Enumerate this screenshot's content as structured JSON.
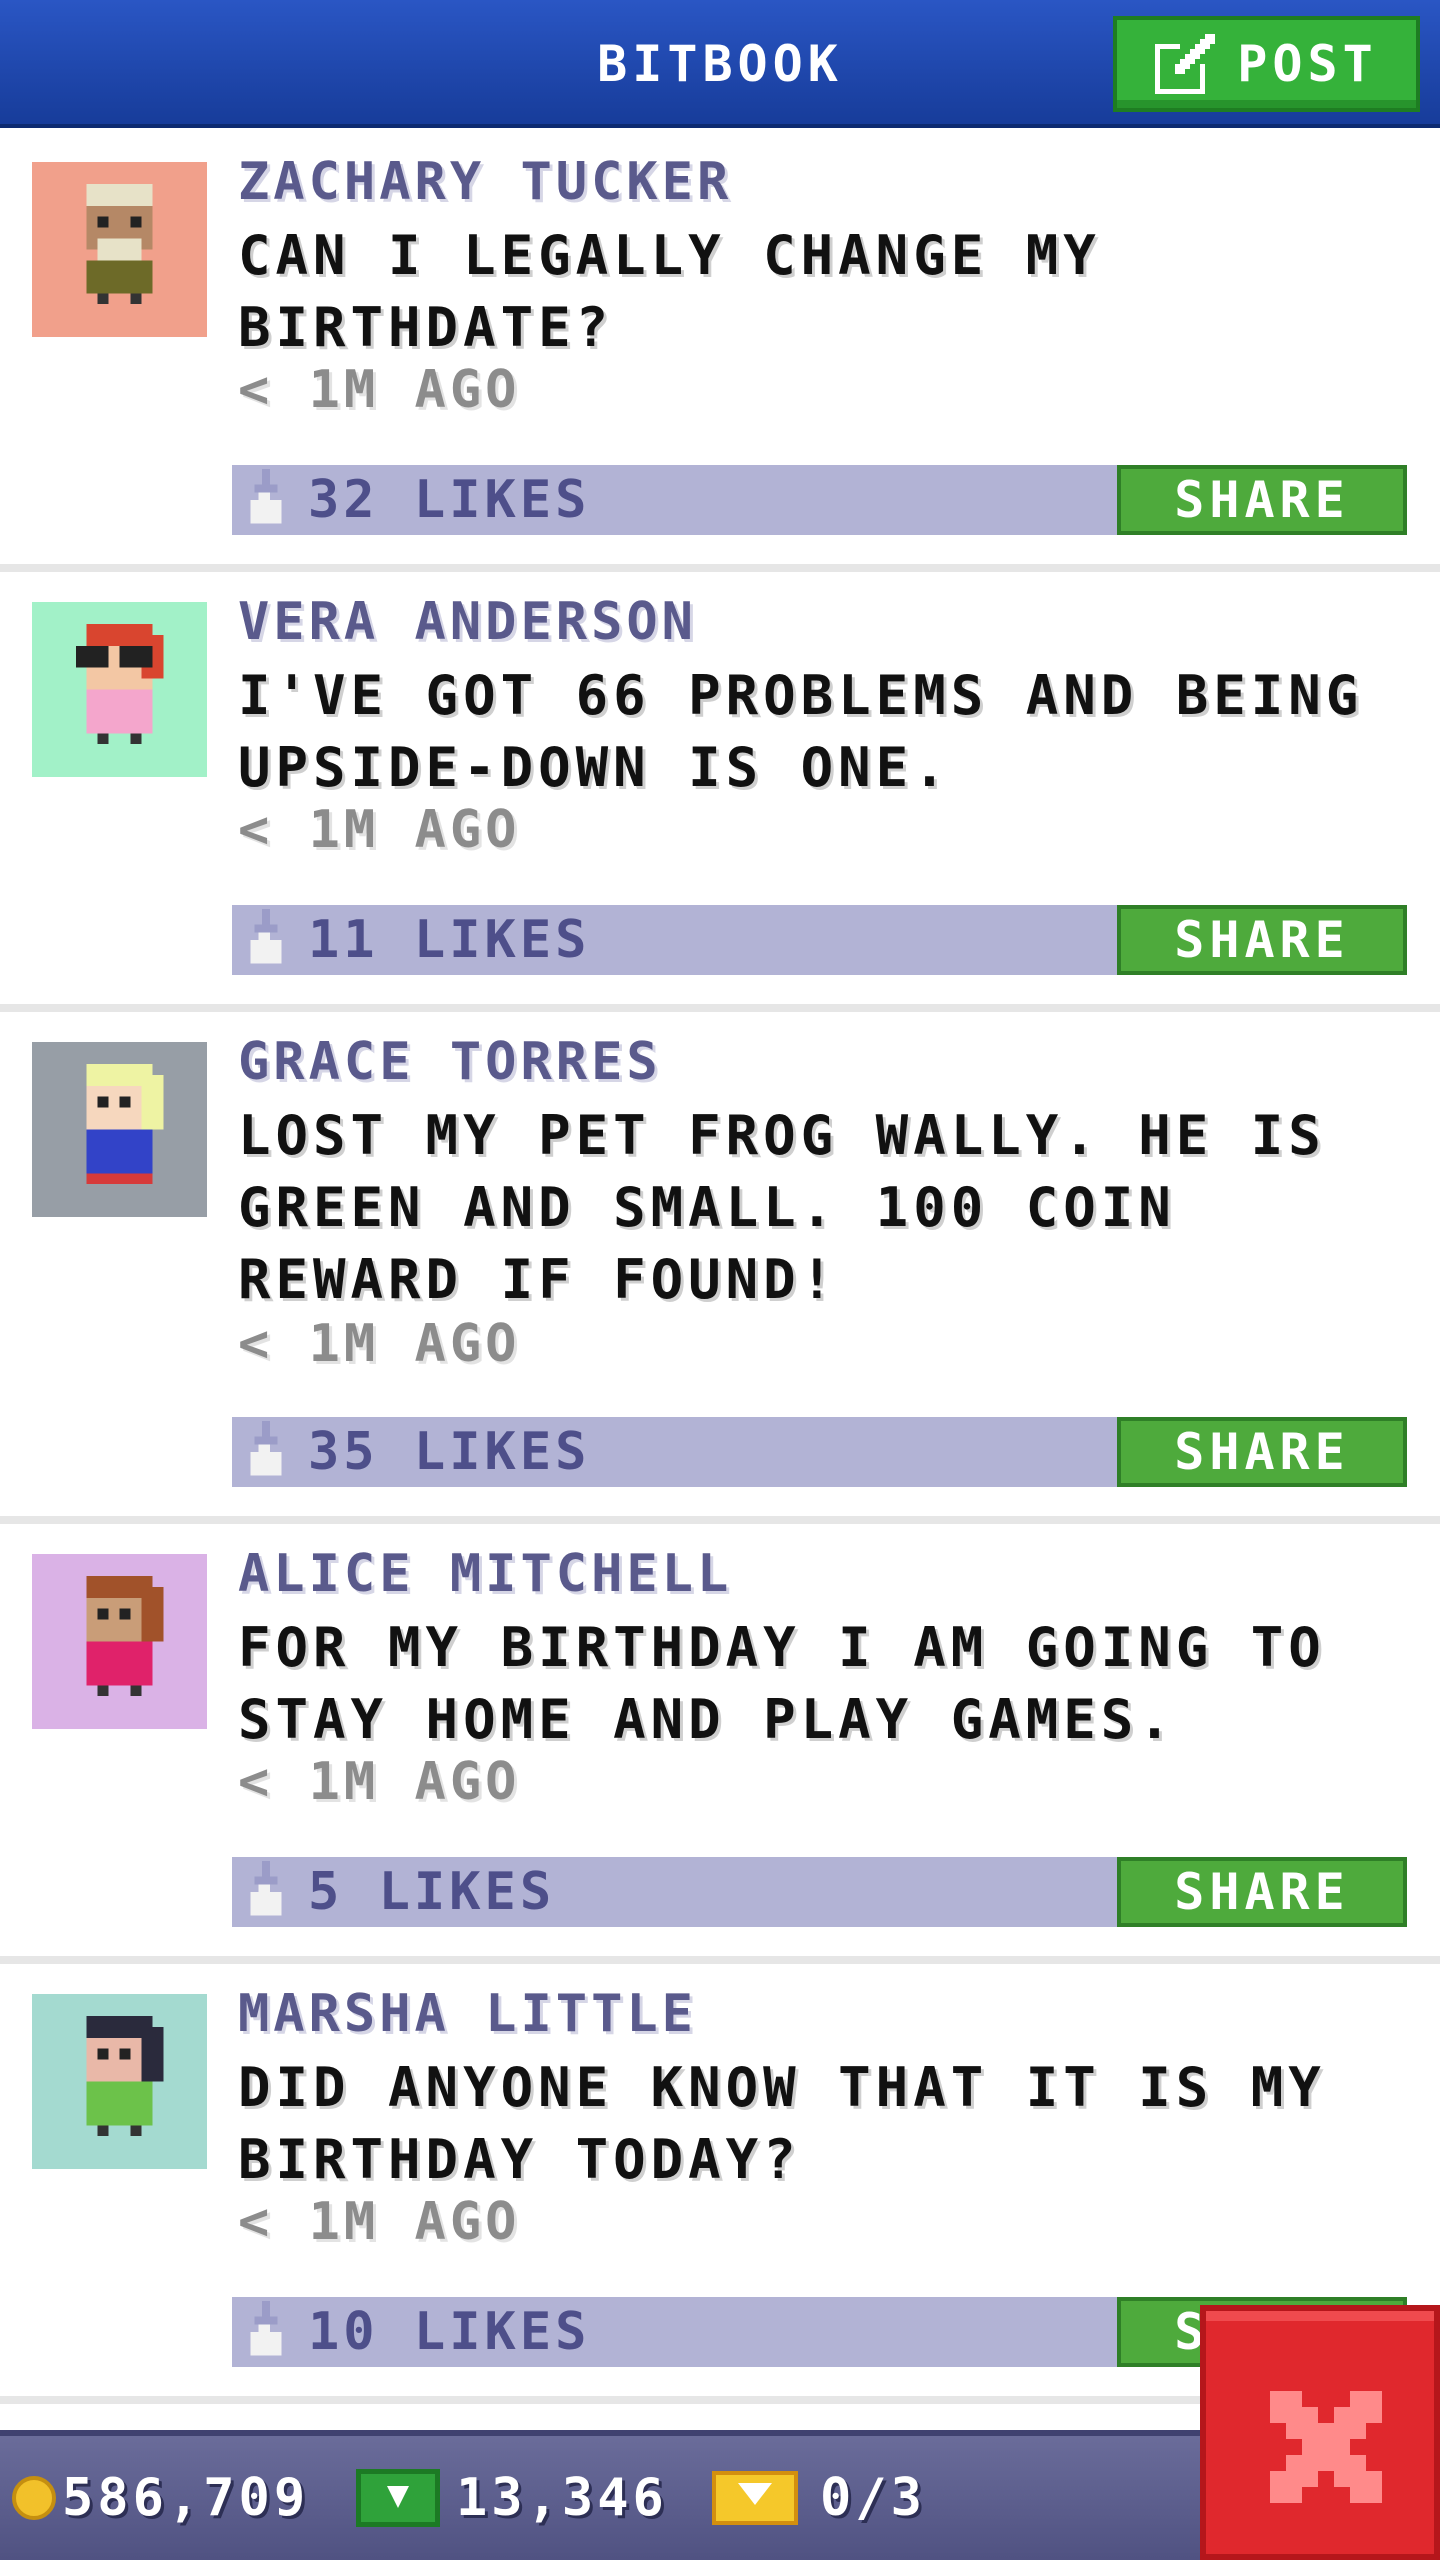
{
  "header": {
    "title": "BITBOOK",
    "post_label": "POST"
  },
  "posts": [
    {
      "author": "ZACHARY TUCKER",
      "message": "CAN I LEGALLY CHANGE MY BIRTHDATE?",
      "time": "< 1M AGO",
      "likes": "32 LIKES",
      "share_label": "SHARE",
      "avatar_bg": "#f1a08b"
    },
    {
      "author": "VERA ANDERSON",
      "message": "I'VE GOT 66 PROBLEMS AND BEING UPSIDE-DOWN IS ONE.",
      "time": "< 1M AGO",
      "likes": "11 LIKES",
      "share_label": "SHARE",
      "avatar_bg": "#a2f1c8"
    },
    {
      "author": "GRACE TORRES",
      "message": "LOST MY PET FROG WALLY. HE IS GREEN AND SMALL. 100 COIN REWARD IF FOUND!",
      "time": "< 1M AGO",
      "likes": "35 LIKES",
      "share_label": "SHARE",
      "avatar_bg": "#979ea6"
    },
    {
      "author": "ALICE MITCHELL",
      "message": "FOR MY BIRTHDAY I AM GOING TO STAY HOME AND PLAY GAMES.",
      "time": "< 1M AGO",
      "likes": "5 LIKES",
      "share_label": "SHARE",
      "avatar_bg": "#dab2e6"
    },
    {
      "author": "MARSHA LITTLE",
      "message": "DID ANYONE KNOW THAT IT IS MY BIRTHDAY TODAY?",
      "time": "< 1M AGO",
      "likes": "10 LIKES",
      "share_label": "SHARE",
      "avatar_bg": "#a4dad0"
    }
  ],
  "footer": {
    "coins": "586,709",
    "bux": "13,346",
    "tickets": "0/3"
  },
  "colors": {
    "header_blue": "#1f47b0",
    "share_green": "#4eaa3c",
    "likes_bar": "#b2b3d5",
    "close_red": "#e0282d"
  },
  "icons": [
    "edit-icon",
    "thumb-up-icon",
    "coin-icon",
    "bux-icon",
    "ticket-icon",
    "close-icon"
  ]
}
